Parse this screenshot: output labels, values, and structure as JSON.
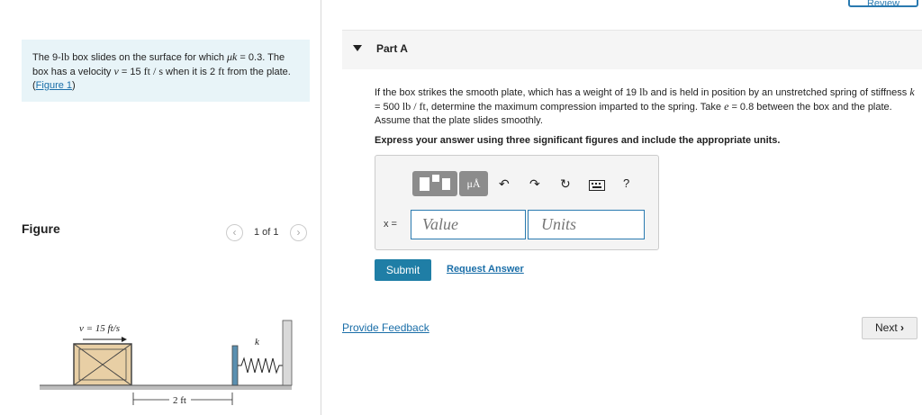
{
  "review_label": "Review",
  "problem": {
    "part1": "The 9-",
    "weight_unit": "lb",
    "part2": " box slides on the surface for which ",
    "mu_symbol": "μk",
    "part3": " = 0.3. The box has a velocity ",
    "v_symbol": "v",
    "part4": " = 15 ",
    "vel_unit": "ft / s",
    "part5": " when it is 2 ",
    "dist_unit": "ft",
    "part6": " from the plate. (",
    "figure_link": "Figure 1",
    "part7": ")"
  },
  "figure": {
    "title": "Figure",
    "counter": "1 of 1",
    "prev_icon": "chevron-left-icon",
    "next_icon": "chevron-right-icon",
    "v_label": "v = 15 ft/s",
    "k_label": "k",
    "dist_label": "2 ft"
  },
  "part_a": {
    "title": "Part A",
    "q1": "If the box strikes the smooth plate, which has a weight of 19 ",
    "q_lb": "lb",
    "q2": " and is held in position by an unstretched spring of stiffness ",
    "q_k": "k",
    "q3": " = 500 ",
    "q_unit": "lb / ft",
    "q4": ", determine the maximum compression imparted to the spring. Take ",
    "q_e": "e",
    "q5": " = 0.8 between the box and the plate. Assume that the plate slides smoothly.",
    "instruction": "Express your answer using three significant figures and include the appropriate units."
  },
  "answer": {
    "label": "x =",
    "value_placeholder": "Value",
    "units_placeholder": "Units",
    "toolbar": {
      "templates_icon": "templates-icon",
      "mu_label": "μÅ",
      "undo_icon": "undo-icon",
      "redo_icon": "redo-icon",
      "reset_icon": "reset-icon",
      "keyboard_icon": "keyboard-icon",
      "help_label": "?"
    }
  },
  "submit_label": "Submit",
  "request_label": "Request Answer",
  "feedback_label": "Provide Feedback",
  "next_label": "Next"
}
